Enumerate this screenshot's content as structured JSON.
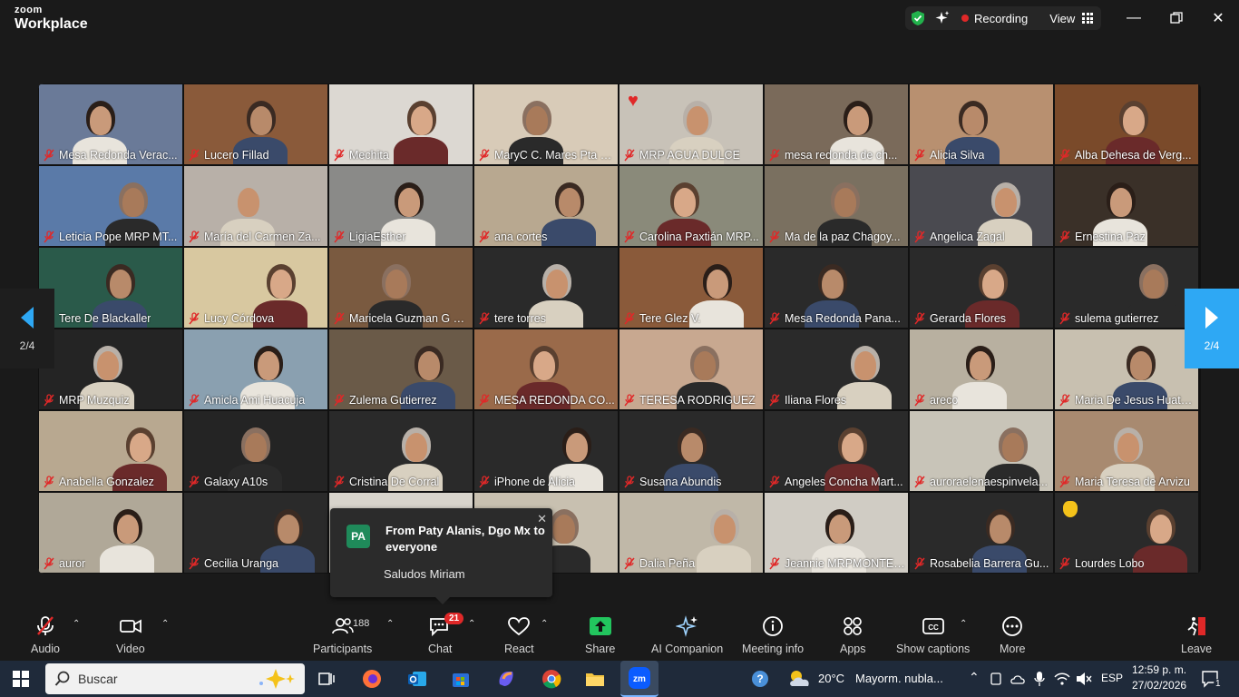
{
  "window": {
    "brand_small": "zoom",
    "brand_big": "Workplace",
    "recording_label": "Recording",
    "view_label": "View"
  },
  "gallery": {
    "page_indicator_left": "2/4",
    "page_indicator_right": "2/4",
    "tiles": [
      {
        "name": "Mesa Redonda Verac...",
        "bg": "#6a7a98"
      },
      {
        "name": "Lucero Fillad",
        "bg": "#8a5a3a"
      },
      {
        "name": "Mechita",
        "bg": "#dcd8d2"
      },
      {
        "name": "MaryC C. Mares Pta Cte ...",
        "bg": "#d8cbb8"
      },
      {
        "name": "MRP AGUA DULCE",
        "bg": "#c8c2b8"
      },
      {
        "name": "mesa redonda de ch...",
        "bg": "#7a6a5a"
      },
      {
        "name": "Alicia Silva",
        "bg": "#b89070"
      },
      {
        "name": "Alba Dehesa de Verg...",
        "bg": "#7a4a2a"
      },
      {
        "name": "Leticia Pope MRP MT...",
        "bg": "#5a7aa8"
      },
      {
        "name": "María del Carmen Za...",
        "bg": "#b8b0a8"
      },
      {
        "name": "LigiaEsther",
        "bg": "#8a8a88"
      },
      {
        "name": "ana cortes",
        "bg": "#b8a890"
      },
      {
        "name": "Carolina Paxtián MRP...",
        "bg": "#8a8a7a"
      },
      {
        "name": "Ma de la paz Chagoy...",
        "bg": "#7a7060"
      },
      {
        "name": "Angelica Zagal",
        "bg": "#4a4a50"
      },
      {
        "name": "Ernestina Paz",
        "bg": "#3a3028"
      },
      {
        "name": "Tere De Blackaller",
        "bg": "#2a5a4a"
      },
      {
        "name": "Lucy Córdova",
        "bg": "#d8c8a0"
      },
      {
        "name": "Maricela Guzman G MR...",
        "bg": "#7a5a40"
      },
      {
        "name": "tere torres",
        "bg": "#2a2a2a"
      },
      {
        "name": "Tere Glez V.",
        "bg": "#8a5a3a"
      },
      {
        "name": "Mesa Redonda Pana...",
        "bg": "#2a2a2a"
      },
      {
        "name": "Gerarda Flores",
        "bg": "#2a2a2a"
      },
      {
        "name": "sulema gutierrez",
        "bg": "#2a2a2a"
      },
      {
        "name": "MRP Muzquiz",
        "bg": "#242424"
      },
      {
        "name": "Amicla Ami Huacuja",
        "bg": "#8aa0b0"
      },
      {
        "name": "Zulema Gutierrez",
        "bg": "#6a5a48"
      },
      {
        "name": "MESA REDONDA CO...",
        "bg": "#9a6a4a"
      },
      {
        "name": "TERESA RODRIGUEZ",
        "bg": "#c8a890"
      },
      {
        "name": "Iliana Flores",
        "bg": "#2a2a2a"
      },
      {
        "name": "areco",
        "bg": "#b8b0a0"
      },
      {
        "name": "Maria De Jesus Huatusc...",
        "bg": "#c8c0b0"
      },
      {
        "name": "Anabella Gonzalez",
        "bg": "#b8a890"
      },
      {
        "name": "Galaxy A10s",
        "bg": "#242424"
      },
      {
        "name": "Cristina De Corral",
        "bg": "#2a2a2a"
      },
      {
        "name": "iPhone de Alicia",
        "bg": "#2a2a2a"
      },
      {
        "name": "Susana Abundis",
        "bg": "#2a2a2a"
      },
      {
        "name": "Angeles Concha Mart...",
        "bg": "#2a2a2a"
      },
      {
        "name": "auroraelenaespinvela...",
        "bg": "#c8c4b8"
      },
      {
        "name": "Maria Teresa de Arvizu",
        "bg": "#a88a70"
      },
      {
        "name": "auror",
        "bg": "#b0a898"
      },
      {
        "name": "Cecilia Uranga",
        "bg": "#2a2a2a"
      },
      {
        "name": "",
        "bg": "#d8d4cc"
      },
      {
        "name": "",
        "bg": "#c8c0b0"
      },
      {
        "name": "Dalia Peña",
        "bg": "#c0b8a8"
      },
      {
        "name": "Jeannie MRPMONTEJ...",
        "bg": "#d0ccc4"
      },
      {
        "name": "Rosabelia Barrera Gu...",
        "bg": "#2a2a2a"
      },
      {
        "name": "Lourdes Lobo",
        "bg": "#2a2a2a"
      }
    ]
  },
  "chat_toast": {
    "avatar": "PA",
    "from": "From Paty Alanis, Dgo Mx to everyone",
    "message": "Saludos Miriam"
  },
  "toolbar": {
    "audio": "Audio",
    "video": "Video",
    "participants": "Participants",
    "participants_count": "188",
    "chat": "Chat",
    "chat_badge": "21",
    "react": "React",
    "share": "Share",
    "ai_companion": "AI Companion",
    "meeting_info": "Meeting info",
    "apps": "Apps",
    "show_captions": "Show captions",
    "more": "More",
    "leave": "Leave"
  },
  "taskbar": {
    "search_placeholder": "Buscar",
    "weather": "20°C",
    "weather_desc": "Mayorm. nubla...",
    "lang": "ESP",
    "time": "12:59 p. m.",
    "date": "27/02/2026",
    "notifications": "1"
  },
  "colors": {
    "accent_blue": "#2ea8f4",
    "share_green": "#22c55e",
    "record_red": "#e02828",
    "mute_red": "#e02828"
  }
}
